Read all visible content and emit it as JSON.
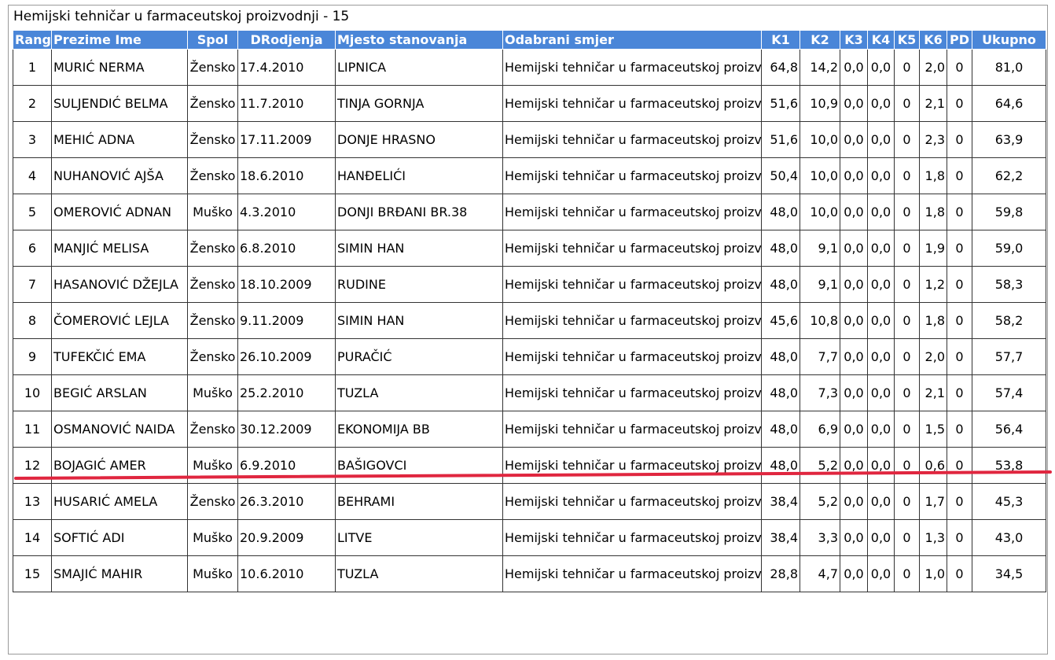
{
  "title": "Hemijski tehničar u farmaceutskoj proizvodnji - 15",
  "colors": {
    "header_bg": "#4a86d8",
    "header_text": "#ffffff",
    "cutoff_line": "#e0263f"
  },
  "columns": [
    "Rang",
    "Prezime Ime",
    "Spol",
    "DRodjenja",
    "Mjesto stanovanja",
    "Odabrani smjer",
    "K1",
    "K2",
    "K3",
    "K4",
    "K5",
    "K6",
    "PD",
    "Ukupno"
  ],
  "rows": [
    [
      "1",
      "MURIĆ NERMA",
      "Žensko",
      "17.4.2010",
      "LIPNICA",
      "Hemijski tehničar u farmaceutskoj proizvodnji",
      "64,8",
      "14,2",
      "0,0",
      "0,0",
      "0",
      "2,0",
      "0",
      "81,0"
    ],
    [
      "2",
      "SULJENDIĆ BELMA",
      "Žensko",
      "11.7.2010",
      "TINJA GORNJA",
      "Hemijski tehničar u farmaceutskoj proizvodnji",
      "51,6",
      "10,9",
      "0,0",
      "0,0",
      "0",
      "2,1",
      "0",
      "64,6"
    ],
    [
      "3",
      "MEHIĆ ADNA",
      "Žensko",
      "17.11.2009",
      "DONJE HRASNO",
      "Hemijski tehničar u farmaceutskoj proizvodnji",
      "51,6",
      "10,0",
      "0,0",
      "0,0",
      "0",
      "2,3",
      "0",
      "63,9"
    ],
    [
      "4",
      "NUHANOVIĆ AJŠA",
      "Žensko",
      "18.6.2010",
      "HANĐELIĆI",
      "Hemijski tehničar u farmaceutskoj proizvodnji",
      "50,4",
      "10,0",
      "0,0",
      "0,0",
      "0",
      "1,8",
      "0",
      "62,2"
    ],
    [
      "5",
      "OMEROVIĆ ADNAN",
      "Muško",
      "4.3.2010",
      "DONJI BRĐANI BR.38",
      "Hemijski tehničar u farmaceutskoj proizvodnji",
      "48,0",
      "10,0",
      "0,0",
      "0,0",
      "0",
      "1,8",
      "0",
      "59,8"
    ],
    [
      "6",
      "MANJIĆ MELISA",
      "Žensko",
      "6.8.2010",
      "SIMIN HAN",
      "Hemijski tehničar u farmaceutskoj proizvodnji",
      "48,0",
      "9,1",
      "0,0",
      "0,0",
      "0",
      "1,9",
      "0",
      "59,0"
    ],
    [
      "7",
      "HASANOVIĆ DŽEJLA",
      "Žensko",
      "18.10.2009",
      "RUDINE",
      "Hemijski tehničar u farmaceutskoj proizvodnji",
      "48,0",
      "9,1",
      "0,0",
      "0,0",
      "0",
      "1,2",
      "0",
      "58,3"
    ],
    [
      "8",
      "ČOMEROVIĆ LEJLA",
      "Žensko",
      "9.11.2009",
      "SIMIN HAN",
      "Hemijski tehničar u farmaceutskoj proizvodnji",
      "45,6",
      "10,8",
      "0,0",
      "0,0",
      "0",
      "1,8",
      "0",
      "58,2"
    ],
    [
      "9",
      "TUFEKČIĆ EMA",
      "Žensko",
      "26.10.2009",
      "PURAČIĆ",
      "Hemijski tehničar u farmaceutskoj proizvodnji",
      "48,0",
      "7,7",
      "0,0",
      "0,0",
      "0",
      "2,0",
      "0",
      "57,7"
    ],
    [
      "10",
      "BEGIĆ ARSLAN",
      "Muško",
      "25.2.2010",
      "TUZLA",
      "Hemijski tehničar u farmaceutskoj proizvodnji",
      "48,0",
      "7,3",
      "0,0",
      "0,0",
      "0",
      "2,1",
      "0",
      "57,4"
    ],
    [
      "11",
      "OSMANOVIĆ NAIDA",
      "Žensko",
      "30.12.2009",
      "EKONOMIJA BB",
      "Hemijski tehničar u farmaceutskoj proizvodnji",
      "48,0",
      "6,9",
      "0,0",
      "0,0",
      "0",
      "1,5",
      "0",
      "56,4"
    ],
    [
      "12",
      "BOJAGIĆ AMER",
      "Muško",
      "6.9.2010",
      "BAŠIGOVCI",
      "Hemijski tehničar u farmaceutskoj proizvodnji",
      "48,0",
      "5,2",
      "0,0",
      "0,0",
      "0",
      "0,6",
      "0",
      "53,8"
    ],
    [
      "13",
      "HUSARIĆ AMELA",
      "Žensko",
      "26.3.2010",
      "BEHRAMI",
      "Hemijski tehničar u farmaceutskoj proizvodnji",
      "38,4",
      "5,2",
      "0,0",
      "0,0",
      "0",
      "1,7",
      "0",
      "45,3"
    ],
    [
      "14",
      "SOFTIĆ ADI",
      "Muško",
      "20.9.2009",
      "LITVE",
      "Hemijski tehničar u farmaceutskoj proizvodnji",
      "38,4",
      "3,3",
      "0,0",
      "0,0",
      "0",
      "1,3",
      "0",
      "43,0"
    ],
    [
      "15",
      "SMAJIĆ MAHIR",
      "Muško",
      "10.6.2010",
      "TUZLA",
      "Hemijski tehničar u farmaceutskoj proizvodnji",
      "28,8",
      "4,7",
      "0,0",
      "0,0",
      "0",
      "1,0",
      "0",
      "34,5"
    ]
  ]
}
